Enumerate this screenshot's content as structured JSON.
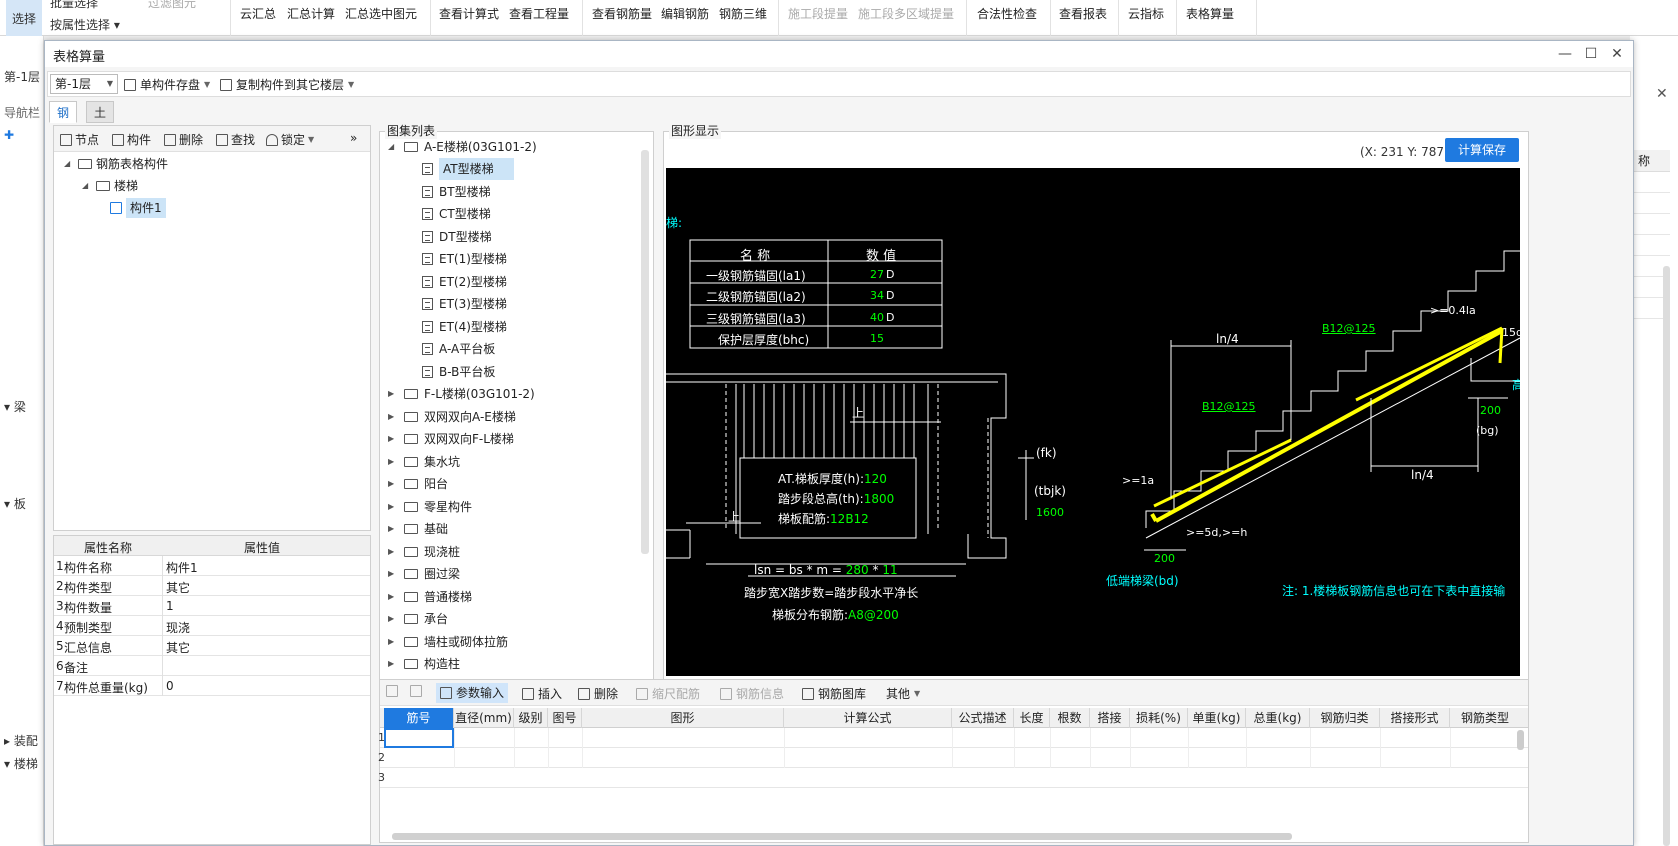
{
  "ribbon": {
    "select_label": "选择",
    "batch_select": "批量选择",
    "filter_elements": "过滤图元",
    "attr_select": "按属性选择",
    "buttons": [
      "云汇总",
      "汇总计算",
      "汇总选中图元",
      "查看计算式",
      "查看工程量",
      "查看钢筋量",
      "编辑钢筋",
      "钢筋三维",
      "施工段提量",
      "施工段多区域提量",
      "合法性检查",
      "查看报表",
      "云指标",
      "表格算量"
    ]
  },
  "bg_left": {
    "floor": "第-1层",
    "nav": "导航栏",
    "items": [
      "梁",
      "板",
      "装配",
      "楼梯"
    ]
  },
  "bg_right": {
    "header": "称"
  },
  "dialog": {
    "title": "表格算量",
    "floor_value": "第-1层",
    "save_single": "单构件存盘",
    "copy_other_floor": "复制构件到其它楼层",
    "tabs": [
      "钢筋",
      "土建"
    ]
  },
  "tree_tools": {
    "node": "节点",
    "component": "构件",
    "delete": "删除",
    "find": "查找",
    "lock": "锁定",
    "more": "»"
  },
  "tree": {
    "root": "钢筋表格构件",
    "child": "楼梯",
    "leaf": "构件1"
  },
  "props": {
    "header_name": "属性名称",
    "header_value": "属性值",
    "rows": [
      {
        "no": "1",
        "name": "构件名称",
        "value": "构件1"
      },
      {
        "no": "2",
        "name": "构件类型",
        "value": "其它"
      },
      {
        "no": "3",
        "name": "构件数量",
        "value": "1"
      },
      {
        "no": "4",
        "name": "预制类型",
        "value": "现浇"
      },
      {
        "no": "5",
        "name": "汇总信息",
        "value": "其它"
      },
      {
        "no": "6",
        "name": "备注",
        "value": ""
      },
      {
        "no": "7",
        "name": "构件总重量(kg)",
        "value": "0"
      }
    ]
  },
  "atlas": {
    "label": "图集列表",
    "group_ae": "A-E楼梯(03G101-2)",
    "ae_items": [
      "AT型楼梯",
      "BT型楼梯",
      "CT型楼梯",
      "DT型楼梯",
      "ET(1)型楼梯",
      "ET(2)型楼梯",
      "ET(3)型楼梯",
      "ET(4)型楼梯",
      "A-A平台板",
      "B-B平台板"
    ],
    "groups": [
      "F-L楼梯(03G101-2)",
      "双网双向A-E楼梯",
      "双网双向F-L楼梯",
      "集水坑",
      "阳台",
      "零星构件",
      "基础",
      "现浇桩",
      "圈过梁",
      "普通楼梯",
      "承台",
      "墙柱或砌体拉筋",
      "构造柱"
    ]
  },
  "graph": {
    "label": "图形显示",
    "coord": "(X: 231 Y: 787)",
    "save_btn": "计算保存",
    "title_frag": "梯:",
    "tbl_head": [
      "名 称",
      "数 值"
    ],
    "tbl_rows": [
      {
        "name": "一级钢筋锚固(la1)",
        "val": "27",
        "unit": "D"
      },
      {
        "name": "二级钢筋锚固(la2)",
        "val": "34",
        "unit": "D"
      },
      {
        "name": "三级钢筋锚固(la3)",
        "val": "40",
        "unit": "D"
      },
      {
        "name": "保护层厚度(bhc)",
        "val": "15",
        "unit": ""
      }
    ],
    "thick_lbl": "AT.梯板厚度(h):",
    "thick_val": "120",
    "height_lbl": "踏步段总高(th):",
    "height_val": "1800",
    "rebar_lbl": "梯板配筋:",
    "rebar_val": "12B12",
    "up1": "上",
    "up2": "上",
    "lsn_lbl": "lsn = bs * m =",
    "lsn_bs": "280",
    "lsn_op": "*",
    "lsn_m": "11",
    "step_eq": "踏步宽X踏步数=踏步段水平净长",
    "dist_lbl": "梯板分布钢筋:",
    "dist_val": "A8@200",
    "fk": "(fk)",
    "tbjk": "(tbjk)",
    "v1600": "1600",
    "ln4a": "ln/4",
    "ln4b": "ln/4",
    "b12a": "B12@125",
    "b12b": "B12@125",
    "ge04": ">=0.4la",
    "ge5d_top": "15d",
    "gela": ">=1a",
    "ge5d": ">=5d,>=h",
    "v200a": "200",
    "v200b": "200",
    "bg": "(bg)",
    "low_beam": "低端梯梁(bd)",
    "note": "注: 1.楼梯板钢筋信息也可在下表中直接输",
    "high_frag": "高"
  },
  "bottom_tools": {
    "param": "参数输入",
    "insert": "插入",
    "delete": "删除",
    "scale": "缩尺配筋",
    "info": "钢筋信息",
    "lib": "钢筋图库",
    "other": "其他"
  },
  "bottom_cols": [
    "筋号",
    "直径(mm)",
    "级别",
    "图号",
    "图形",
    "计算公式",
    "公式描述",
    "长度",
    "根数",
    "搭接",
    "损耗(%)",
    "单重(kg)",
    "总重(kg)",
    "钢筋归类",
    "搭接形式",
    "钢筋类型"
  ],
  "bottom_rows": [
    "1",
    "2",
    "3"
  ],
  "colors": {
    "accent": "#1f7ae0",
    "cad_yellow": "#ffff00",
    "cad_green": "#00ff00",
    "cad_cyan": "#00ffff"
  }
}
